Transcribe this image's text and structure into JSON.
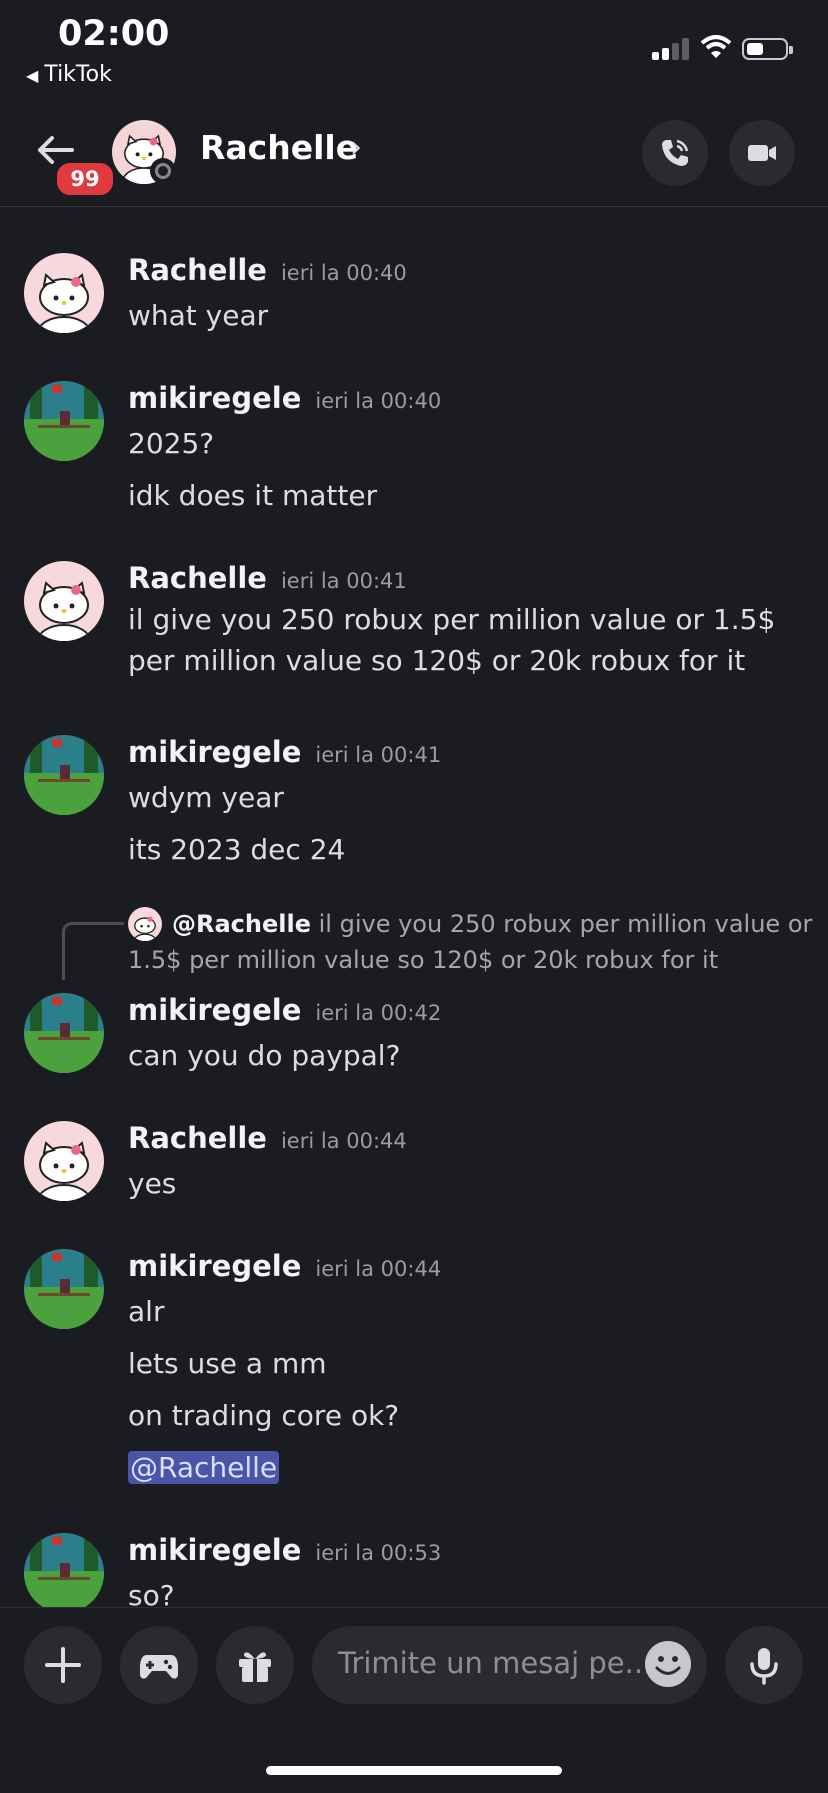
{
  "status_bar": {
    "time": "02:00",
    "back_app": "TikTok"
  },
  "header": {
    "contact_name": "Rachelle",
    "unread_badge": "99"
  },
  "messages": [
    {
      "author": "Rachelle",
      "timestamp": "ieri la 00:40",
      "lines": [
        "what year"
      ]
    },
    {
      "author": "mikiregele",
      "timestamp": "ieri la 00:40",
      "lines": [
        "2025?",
        "idk does it matter"
      ]
    },
    {
      "author": "Rachelle",
      "timestamp": "ieri la 00:41",
      "lines": [
        "il give you 250 robux per million value or 1.5$ per million value so 120$ or 20k robux for it"
      ]
    },
    {
      "author": "mikiregele",
      "timestamp": "ieri la 00:41",
      "lines": [
        "wdym year",
        "its 2023 dec 24"
      ]
    },
    {
      "author": "mikiregele",
      "timestamp": "ieri la 00:42",
      "reply_to": {
        "author": "@Rachelle",
        "text": "il give you 250 robux per million value or 1.5$ per million value so 120$ or 20k robux for it"
      },
      "lines": [
        "can you do paypal?"
      ]
    },
    {
      "author": "Rachelle",
      "timestamp": "ieri la 00:44",
      "lines": [
        "yes"
      ]
    },
    {
      "author": "mikiregele",
      "timestamp": "ieri la 00:44",
      "lines": [
        "alr",
        "lets use a mm",
        "on trading core ok?"
      ],
      "mention": "@Rachelle"
    },
    {
      "author": "mikiregele",
      "timestamp": "ieri la 00:53",
      "lines": [
        "so?"
      ]
    }
  ],
  "composer": {
    "placeholder": "Trimite un mesaj pe..."
  },
  "colors": {
    "background": "#1b1c21",
    "badge": "#e03a3e",
    "mention_bg": "#4b55a8"
  }
}
